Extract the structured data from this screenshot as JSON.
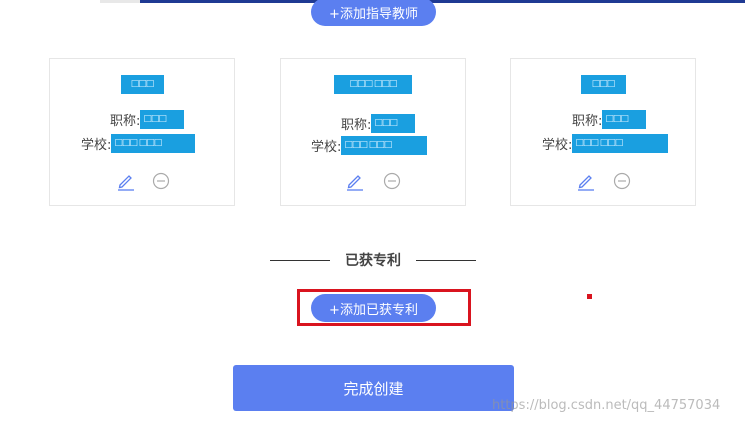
{
  "buttons": {
    "add_teacher": "+添加指导教师",
    "add_patent": "+添加已获专利",
    "finish": "完成创建"
  },
  "cards": [
    {
      "title_label": "职称:",
      "school_label": "学校:",
      "name_mask": "□□□",
      "title_mask": "□□□",
      "school_mask": "□□□ □□□"
    },
    {
      "title_label": "职称:",
      "school_label": "学校:",
      "name_mask": "□□□ □□□",
      "title_mask": "□□□",
      "school_mask": "□□□ □□□"
    },
    {
      "title_label": "职称:",
      "school_label": "学校:",
      "name_mask": "□□□",
      "title_mask": "□□□",
      "school_mask": "□□□ □□□"
    }
  ],
  "section": {
    "title": "已获专利"
  },
  "watermark": "https://blog.csdn.net/qq_44757034",
  "colors": {
    "primary": "#5b7ff0",
    "mask": "#1a9fe0",
    "highlight": "#d9141f",
    "icon": "#5b7ff0",
    "remove_icon": "#aaaaaa"
  },
  "icons": [
    "edit-icon",
    "remove-icon"
  ]
}
